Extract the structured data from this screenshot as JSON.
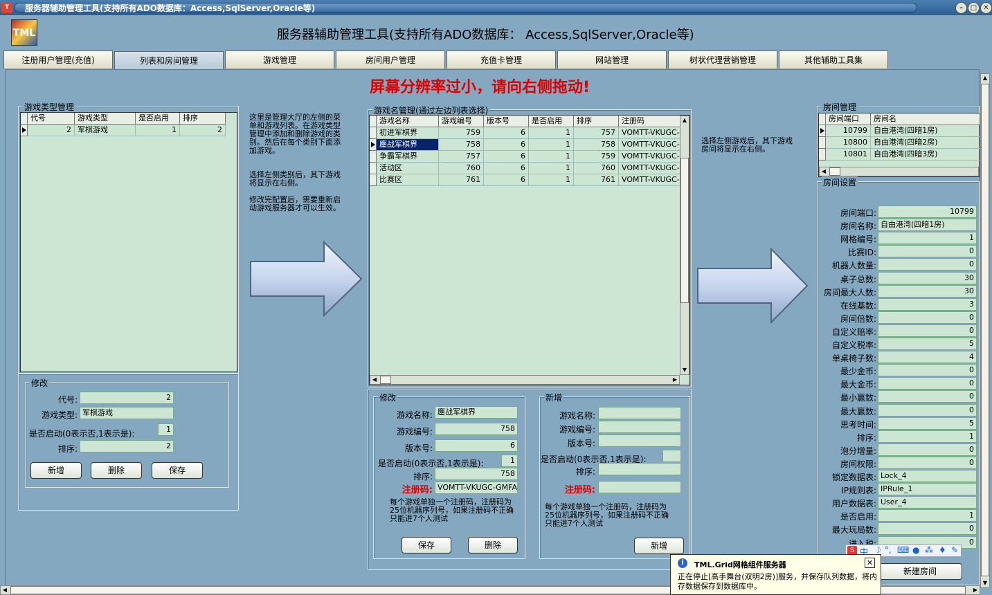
{
  "window": {
    "title": "服务器辅助管理工具(支持所有ADO数据库：Access,SqlServer,Oracle等)"
  },
  "header": {
    "logo": "TML",
    "title": "服务器辅助管理工具(支持所有ADO数据库： Access,SqlServer,Oracle等)"
  },
  "tabs": [
    {
      "label": "注册用户管理(充值)"
    },
    {
      "label": "列表和房间管理"
    },
    {
      "label": "游戏管理"
    },
    {
      "label": "房间用户管理"
    },
    {
      "label": "充值卡管理"
    },
    {
      "label": "网站管理"
    },
    {
      "label": "树状代理营销管理"
    },
    {
      "label": "其他辅助工具集"
    }
  ],
  "warning": "屏幕分辨率过小，请向右侧拖动!",
  "type_panel": {
    "title": "游戏类型管理",
    "columns": [
      "代号",
      "游戏类型",
      "是否启用",
      "排序"
    ],
    "rows": [
      {
        "id": "2",
        "type": "军棋游戏",
        "enabled": "1",
        "order": "2"
      }
    ]
  },
  "type_edit": {
    "title": "修改",
    "id_label": "代号:",
    "id_value": "2",
    "type_label": "游戏类型:",
    "type_value": "军棋游戏",
    "enabled_label": "是否启动(0表示否,1表示是):",
    "enabled_value": "1",
    "order_label": "排序:",
    "order_value": "2",
    "add": "新增",
    "delete": "删除",
    "save": "保存"
  },
  "note1": "这里是管理大厅的左侧的菜单和游戏列表。在游戏类型管理中添加和删除游戏的类别。然后在每个类别下面添加游戏。",
  "note2": "选择左侧类别后，其下游戏将显示在右侧。",
  "note3": "修改完配置后，需要重新启动游戏服务器才可以生效。",
  "game_panel": {
    "title": "游戏名管理(通过左边列表选择)",
    "columns": [
      "游戏名称",
      "游戏编号",
      "版本号",
      "是否启用",
      "排序",
      "注册码"
    ],
    "rows": [
      {
        "name": "初进军棋界",
        "id": "759",
        "ver": "6",
        "enabled": "1",
        "order": "757",
        "code": "VOMTT-VKUGC-GMI"
      },
      {
        "name": "鏖战军棋界",
        "id": "758",
        "ver": "6",
        "enabled": "1",
        "order": "758",
        "code": "VOMTT-VKUGC-GMI"
      },
      {
        "name": "争霸军棋界",
        "id": "757",
        "ver": "6",
        "enabled": "1",
        "order": "759",
        "code": "VOMTT-VKUGC-GMI"
      },
      {
        "name": "活动区",
        "id": "760",
        "ver": "6",
        "enabled": "1",
        "order": "760",
        "code": "VOMTT-VKUGC-GMI"
      },
      {
        "name": "比赛区",
        "id": "761",
        "ver": "6",
        "enabled": "1",
        "order": "761",
        "code": "VOMTT-VKUGC-GMI"
      }
    ]
  },
  "game_edit": {
    "title": "修改",
    "name_label": "游戏名称:",
    "name_value": "鏖战军棋界",
    "id_label": "游戏编号:",
    "id_value": "758",
    "ver_label": "版本号:",
    "ver_value": "6",
    "enabled_label": "是否启动(0表示否,1表示是):",
    "enabled_value": "1",
    "order_label": "排序:",
    "order_value": "758",
    "code_label": "注册码:",
    "code_value": "VOMTT-VKUGC-GMFAM-V.",
    "note": "每个游戏单独一个注册码，注册码为25位机器序列号，如果注册码不正确只能进7个人测试",
    "save": "保存",
    "delete": "删除"
  },
  "game_new": {
    "title": "新增",
    "name_label": "游戏名称:",
    "id_label": "游戏编号:",
    "ver_label": "版本号:",
    "enabled_label": "是否启动(0表示否,1表示是):",
    "order_label": "排序:",
    "code_label": "注册码:",
    "note": "每个游戏单独一个注册码，注册码为25位机器序列号，如果注册码不正确只能进7个人测试",
    "add": "新增"
  },
  "note4": "选择左侧游戏后，其下游戏房间将显示在右侧。",
  "room_panel": {
    "title": "房间管理",
    "columns": [
      "房间端口",
      "房间名"
    ],
    "rows": [
      {
        "port": "10799",
        "name": "自由港湾(四暗1房)"
      },
      {
        "port": "10800",
        "name": "自由港湾(四暗2房)"
      },
      {
        "port": "10801",
        "name": "自由港湾(四暗3房)"
      }
    ]
  },
  "room_settings": {
    "title": "房间设置",
    "fields": [
      {
        "label": "房间端口:",
        "value": "10799"
      },
      {
        "label": "房间名称:",
        "value": "自由港湾(四暗1房)"
      },
      {
        "label": "网格编号:",
        "value": "1"
      },
      {
        "label": "比赛ID:",
        "value": "0"
      },
      {
        "label": "机器人数量:",
        "value": "0"
      },
      {
        "label": "桌子总数:",
        "value": "30"
      },
      {
        "label": "房间最大人数:",
        "value": "30"
      },
      {
        "label": "在线基数:",
        "value": "3"
      },
      {
        "label": "房间倍数:",
        "value": "0"
      },
      {
        "label": "自定义赔率:",
        "value": "0"
      },
      {
        "label": "自定义税率:",
        "value": "5"
      },
      {
        "label": "单桌椅子数:",
        "value": "4"
      },
      {
        "label": "最少金币:",
        "value": "0"
      },
      {
        "label": "最大金币:",
        "value": "0"
      },
      {
        "label": "最小赢数:",
        "value": "0"
      },
      {
        "label": "最大赢数:",
        "value": "0"
      },
      {
        "label": "思考时间:",
        "value": "5"
      },
      {
        "label": "排序:",
        "value": "1"
      },
      {
        "label": "泡分增量:",
        "value": "0"
      },
      {
        "label": "房间权限:",
        "value": "0"
      },
      {
        "label": "锁定数据表:",
        "value": "Lock_4"
      },
      {
        "label": "IP规则表:",
        "value": "IPRule_1"
      },
      {
        "label": "用户数据表:",
        "value": "User_4"
      },
      {
        "label": "是否启用:",
        "value": "1"
      },
      {
        "label": "最大玩局数:",
        "value": "0"
      },
      {
        "label": "进入税:",
        "value": "0"
      }
    ],
    "new_room": "新建房间"
  },
  "ime": {
    "label": "中"
  },
  "popup": {
    "title": "TML.Grid网格组件服务器",
    "text": "正在停止[高手舞台(双明2房)]服务，并保存队列数据，将内存数据保存到数据库中。"
  },
  "colors": {
    "grid_bg": "#cde6d4",
    "warning": "#e00000",
    "background": "#84a8c0"
  }
}
